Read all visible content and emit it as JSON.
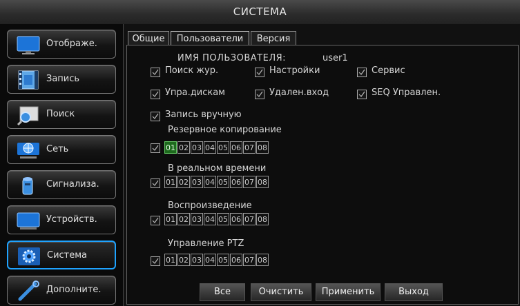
{
  "window": {
    "title": "СИСТЕМА"
  },
  "sidebar": {
    "items": [
      {
        "label": "Отображе.",
        "icon": "monitor-icon"
      },
      {
        "label": "Запись",
        "icon": "film-icon"
      },
      {
        "label": "Поиск",
        "icon": "magnifier-icon"
      },
      {
        "label": "Сеть",
        "icon": "network-icon"
      },
      {
        "label": "Сигнализа.",
        "icon": "alarm-icon"
      },
      {
        "label": "Устройств.",
        "icon": "device-icon"
      },
      {
        "label": "Система",
        "icon": "gear-icon",
        "active": true
      },
      {
        "label": "Дополните.",
        "icon": "wrench-icon"
      }
    ]
  },
  "tabs": [
    {
      "label": "Общие"
    },
    {
      "label": "Пользователи",
      "active": true
    },
    {
      "label": "Версия"
    }
  ],
  "user": {
    "label": "ИМЯ ПОЛЬЗОВАТЕЛЯ:",
    "value": "user1"
  },
  "permissions": {
    "log_search": "Поиск жур.",
    "settings": "Настройки",
    "service": "Сервис",
    "disk_mgmt": "Упра.дискам",
    "remote_login": "Удален.вход",
    "seq_control": "SEQ Управлен.",
    "manual_record": "Запись вручную"
  },
  "channel_groups": {
    "backup": {
      "label": "Резервное копирование",
      "selected": "01"
    },
    "live": {
      "label": "В реальном времени"
    },
    "playback": {
      "label": "Воспроизведение"
    },
    "ptz": {
      "label": "Управление PTZ"
    }
  },
  "channels": [
    "01",
    "02",
    "03",
    "04",
    "05",
    "06",
    "07",
    "08"
  ],
  "buttons": {
    "all": "Все",
    "clear": "Очистить",
    "apply": "Применить",
    "exit": "Выход"
  },
  "colors": {
    "accent": "#1fa3ff",
    "selected_channel": "#1d6a1d"
  }
}
